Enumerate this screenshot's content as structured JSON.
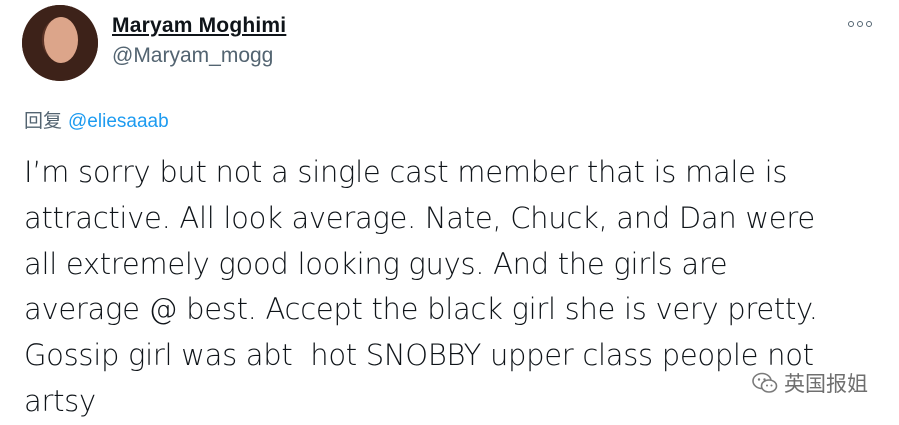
{
  "tweet": {
    "display_name": "Maryam Moghimi",
    "handle": "@Maryam_mogg",
    "reply_prefix": "回复",
    "reply_mention": "@eliesaaab",
    "body_lines": [
      "I’m sorry but not a single cast member that is male is",
      "attractive. All look average. Nate, Chuck, and Dan were",
      "all extremely good looking guys. And the girls are",
      "average @ best. Accept the black girl she is very pretty.",
      "Gossip girl was abt  hot SNOBBY upper class people not",
      "artsy"
    ]
  },
  "watermark": {
    "text": "英国报姐",
    "icon": "wechat-icon"
  },
  "icons": {
    "more": "more-options-icon"
  },
  "colors": {
    "text": "#0f1419",
    "secondary": "#536471",
    "link": "#1d9bf0"
  }
}
